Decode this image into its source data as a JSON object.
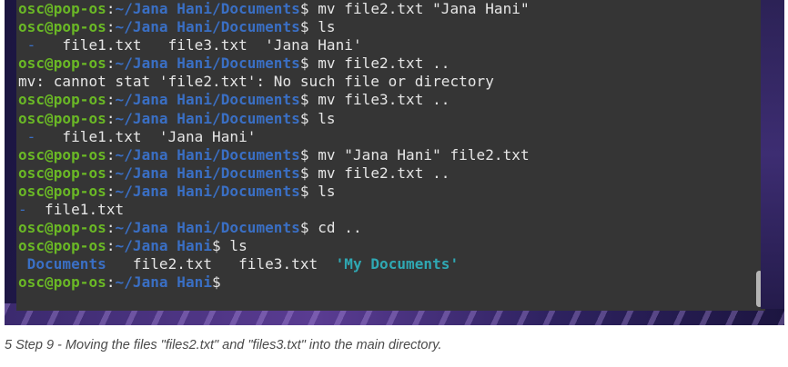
{
  "prompt": {
    "user": "osc@pop-os",
    "sep": ":",
    "dollar": "$ "
  },
  "terminal": {
    "lines": [
      {
        "type": "cmd",
        "path": "~/Jana Hani/Documents",
        "cmd": "mv file2.txt \"Jana Hani\""
      },
      {
        "type": "cmd",
        "path": "~/Jana Hani/Documents",
        "cmd": "ls"
      },
      {
        "type": "out",
        "dash": " -",
        "text": "   file1.txt   file3.txt  'Jana Hani'"
      },
      {
        "type": "cmd",
        "path": "~/Jana Hani/Documents",
        "cmd": "mv file2.txt .."
      },
      {
        "type": "plain",
        "text": "mv: cannot stat 'file2.txt': No such file or directory"
      },
      {
        "type": "cmd",
        "path": "~/Jana Hani/Documents",
        "cmd": "mv file3.txt .."
      },
      {
        "type": "cmd",
        "path": "~/Jana Hani/Documents",
        "cmd": "ls"
      },
      {
        "type": "out",
        "dash": " -",
        "text": "   file1.txt  'Jana Hani'"
      },
      {
        "type": "cmd",
        "path": "~/Jana Hani/Documents",
        "cmd": "mv \"Jana Hani\" file2.txt"
      },
      {
        "type": "cmd",
        "path": "~/Jana Hani/Documents",
        "cmd": "mv file2.txt .."
      },
      {
        "type": "cmd",
        "path": "~/Jana Hani/Documents",
        "cmd": "ls"
      },
      {
        "type": "out",
        "dash": "-",
        "text": "  file1.txt"
      },
      {
        "type": "cmd",
        "path": "~/Jana Hani/Documents",
        "cmd": "cd .."
      },
      {
        "type": "cmd",
        "path": "~/Jana Hani",
        "cmd": "ls"
      },
      {
        "type": "listing",
        "items": [
          {
            "text": " Documents",
            "kind": "dir"
          },
          {
            "text": "   file2.txt",
            "kind": "file"
          },
          {
            "text": "   file3.txt",
            "kind": "file"
          },
          {
            "text": "  'My Documents'",
            "kind": "quoted"
          }
        ]
      },
      {
        "type": "cmd",
        "path": "~/Jana Hani",
        "cmd": ""
      }
    ]
  },
  "caption": "5 Step 9 - Moving the files \"files2.txt\" and \"files3.txt\" into the main directory.",
  "colors": {
    "user": "#6ab825",
    "path": "#3a6fc4",
    "text": "#e6e6e6",
    "background": "#353535",
    "quoted_dir": "#2fa8b3"
  }
}
